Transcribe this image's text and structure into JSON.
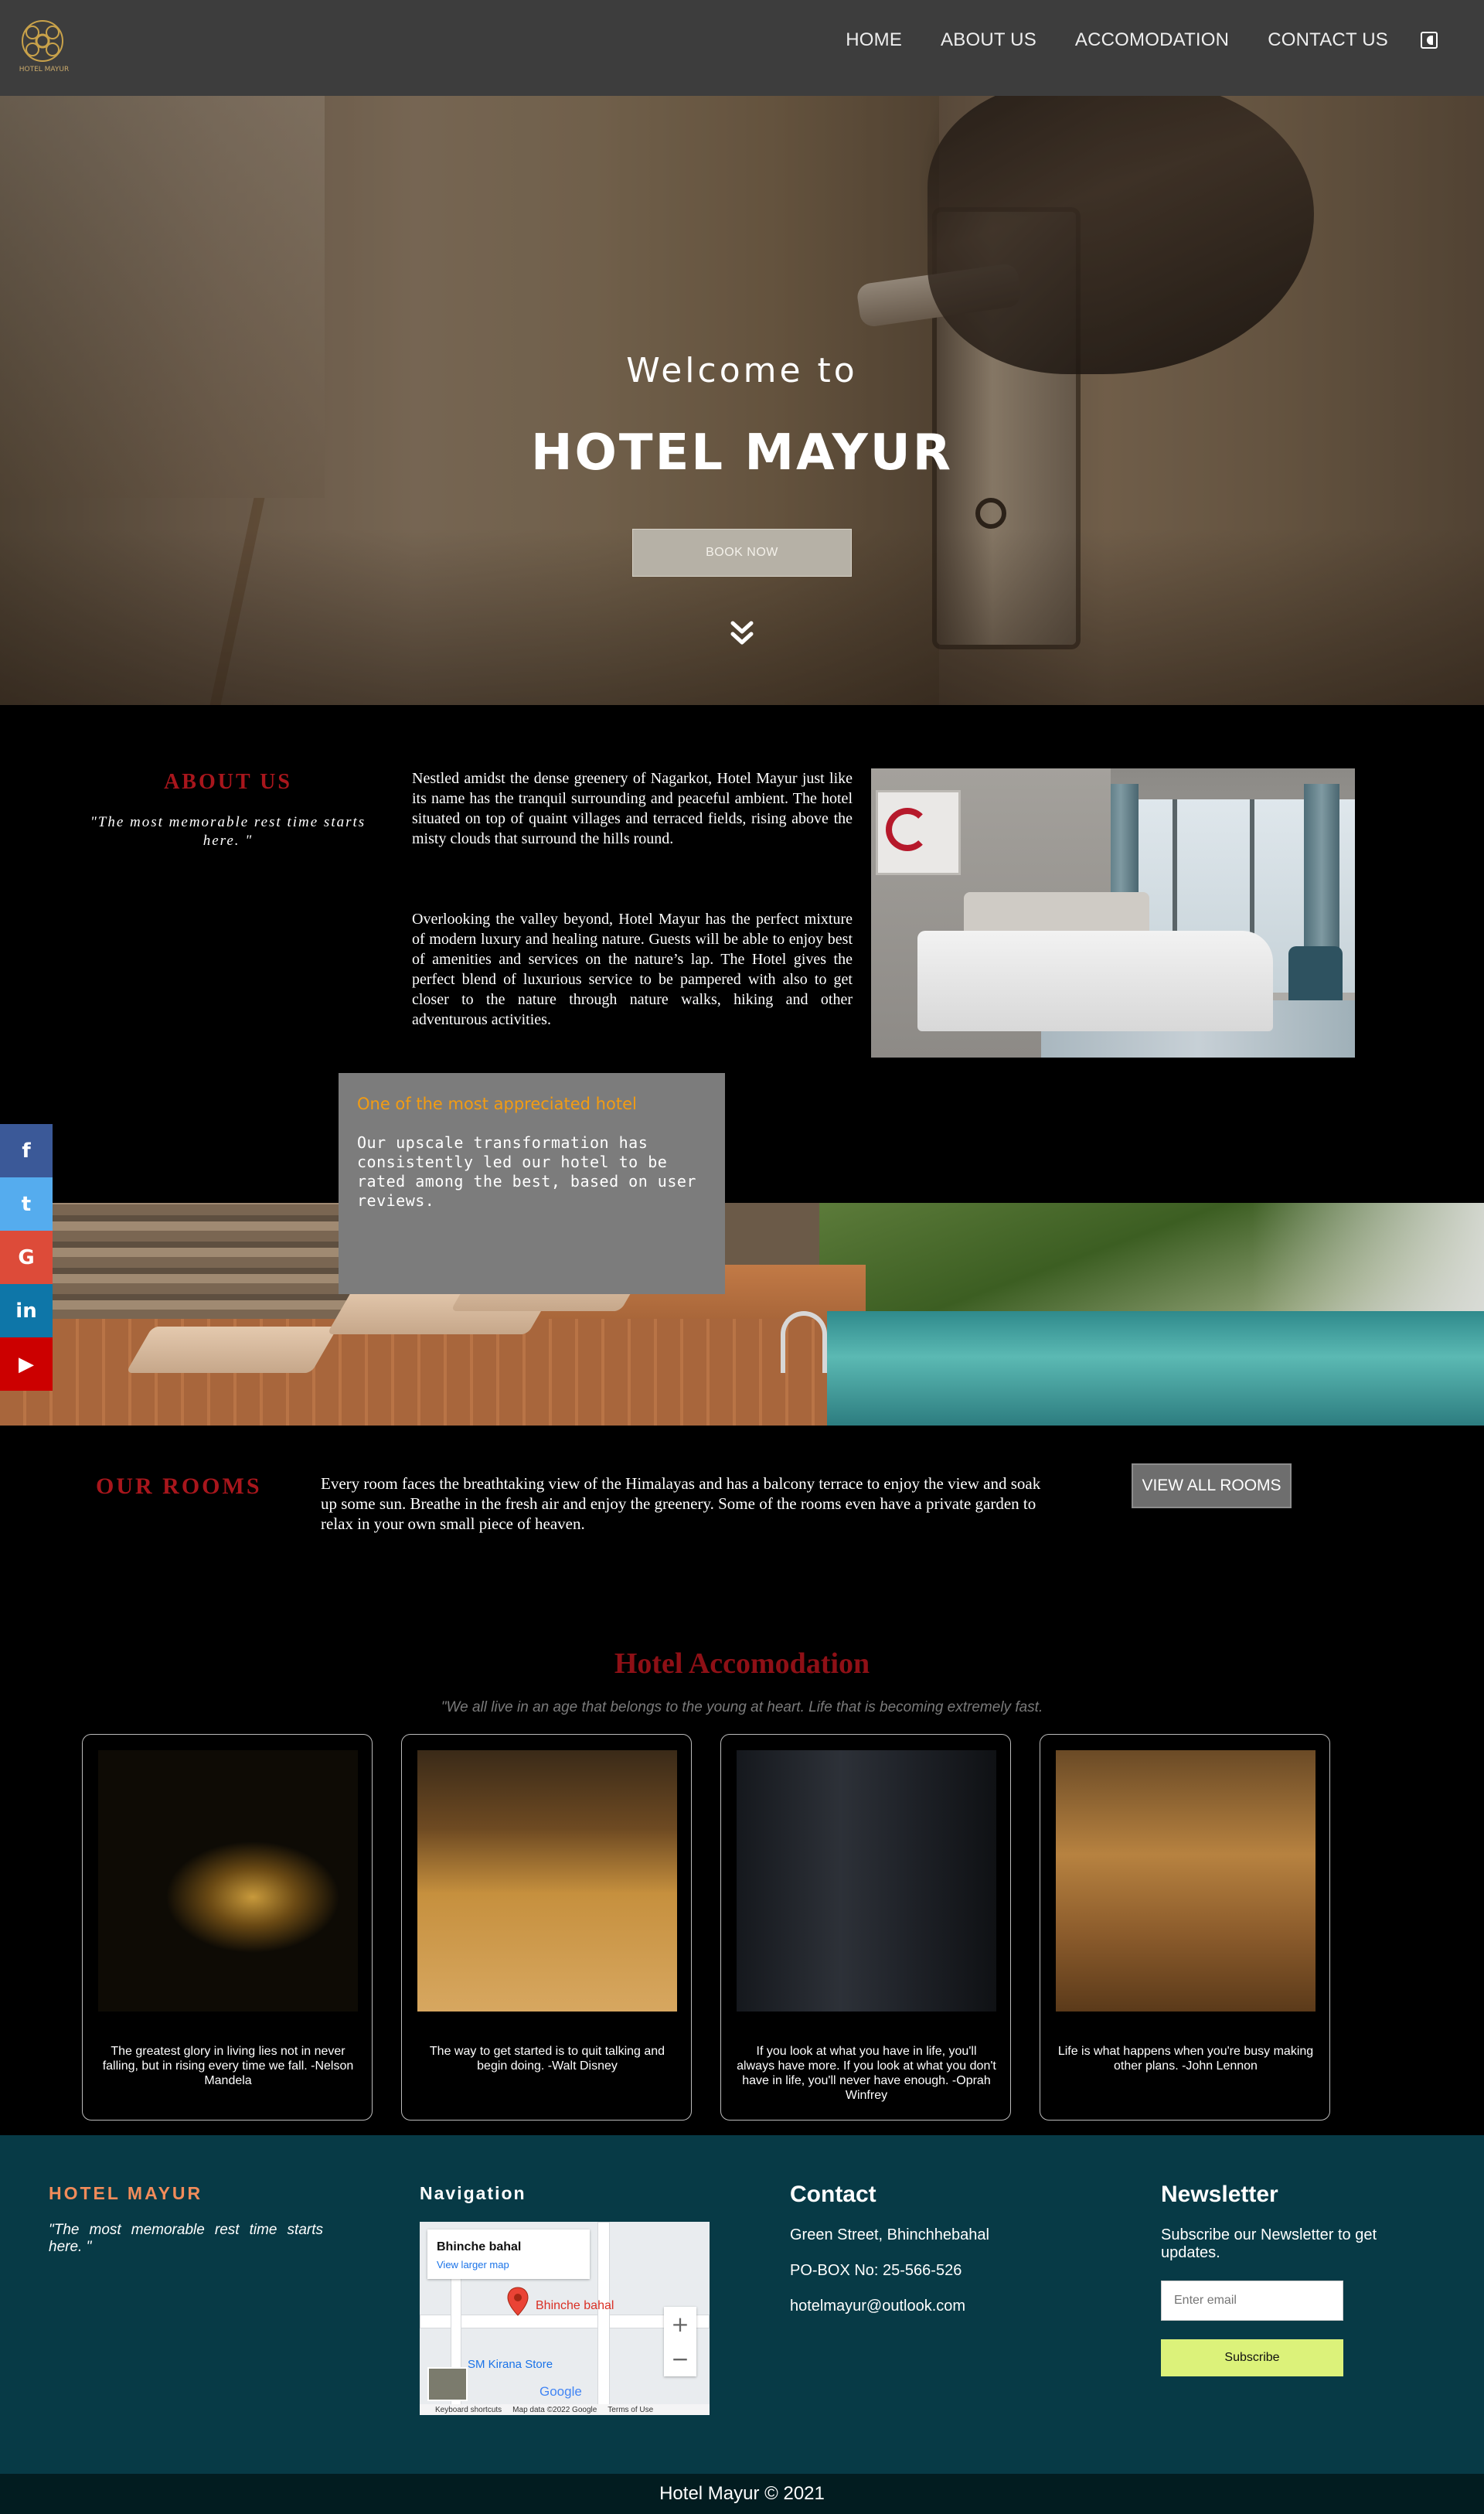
{
  "nav": {
    "logo_text": "HOTEL MAYUR",
    "links": [
      "HOME",
      "ABOUT US",
      "ACCOMODATION",
      "CONTACT US"
    ],
    "toggle_icon": "contrast-toggle-icon"
  },
  "hero": {
    "subtitle": "Welcome to",
    "title": "HOTEL MAYUR",
    "book_label": "BOOK NOW",
    "scroll_icon": "double-chevron-down-icon"
  },
  "about": {
    "title": "ABOUT US",
    "quote": "\"The most memorable rest time starts here. \"",
    "p1": "Nestled amidst the dense greenery of Nagarkot, Hotel Mayur just like its name has the tranquil surrounding and peaceful ambient. The hotel situated on top of quaint villages and terraced fields, rising above the misty clouds that surround the hills round.",
    "p2": "Overlooking the valley beyond, Hotel Mayur has the perfect mixture of modern luxury and healing nature. Guests will be able to enjoy best of amenities and services on the nature’s lap. The Hotel gives the perfect blend of luxurious service to be pampered with also to get closer to the nature through nature walks, hiking and other adventurous activities."
  },
  "appreciated": {
    "title": "One of the most appreciated hotel",
    "text": "Our upscale transformation has consistently led our hotel to be rated among the best, based on user reviews."
  },
  "social": [
    {
      "name": "facebook-icon",
      "glyph": "f",
      "color": "#3b5998"
    },
    {
      "name": "twitter-icon",
      "glyph": "t",
      "color": "#55acee"
    },
    {
      "name": "google-icon",
      "glyph": "G",
      "color": "#dd4b39"
    },
    {
      "name": "linkedin-icon",
      "glyph": "in",
      "color": "#0e76a8"
    },
    {
      "name": "youtube-icon",
      "glyph": "▶",
      "color": "#cc0000"
    }
  ],
  "rooms": {
    "title": "OUR ROOMS",
    "text": "Every room faces the breathtaking view of the Himalayas and has a balcony terrace to enjoy the view and soak up some sun. Breathe in the fresh air and enjoy the greenery. Some of the rooms even have a private garden to relax in your own small piece of heaven.",
    "button": "VIEW ALL ROOMS"
  },
  "accomodation": {
    "title": "Hotel Accomodation",
    "quote": "\"We all live in an age that belongs to the young at heart. Life that is becoming extremely fast.",
    "cards": [
      {
        "caption": "The greatest glory in living lies not in never falling, but in rising every time we fall. -Nelson Mandela"
      },
      {
        "caption": "The way to get started is to quit talking and begin doing. -Walt Disney"
      },
      {
        "caption": "If you look at what you have in life, you'll always have more. If you look at what you don't have in life, you'll never have enough. -Oprah Winfrey"
      },
      {
        "caption": "Life is what happens when you're busy making other plans. -John Lennon"
      }
    ]
  },
  "footer": {
    "brand": "HOTEL MAYUR",
    "quote": "\"The most memorable rest time starts here. \"",
    "nav_title": "Navigation",
    "map": {
      "place": "Bhinche bahal",
      "larger": "View larger map",
      "pin_label": "Bhinche bahal",
      "store": "SM Kirana Store",
      "google": "Google",
      "shortcuts": "Keyboard shortcuts",
      "mapdata": "Map data ©2022 Google",
      "terms": "Terms of Use",
      "zoom_in": "+",
      "zoom_out": "−"
    },
    "contact_title": "Contact",
    "contact_lines": [
      "Green Street, Bhinchhebahal",
      "PO-BOX No: 25-566-526",
      "hotelmayur@outlook.com"
    ],
    "newsletter_title": "Newsletter",
    "newsletter_text": "Subscribe our Newsletter to get updates.",
    "email_placeholder": "Enter email",
    "subscribe_label": "Subscribe",
    "copyright": "Hotel Mayur © 2021"
  }
}
